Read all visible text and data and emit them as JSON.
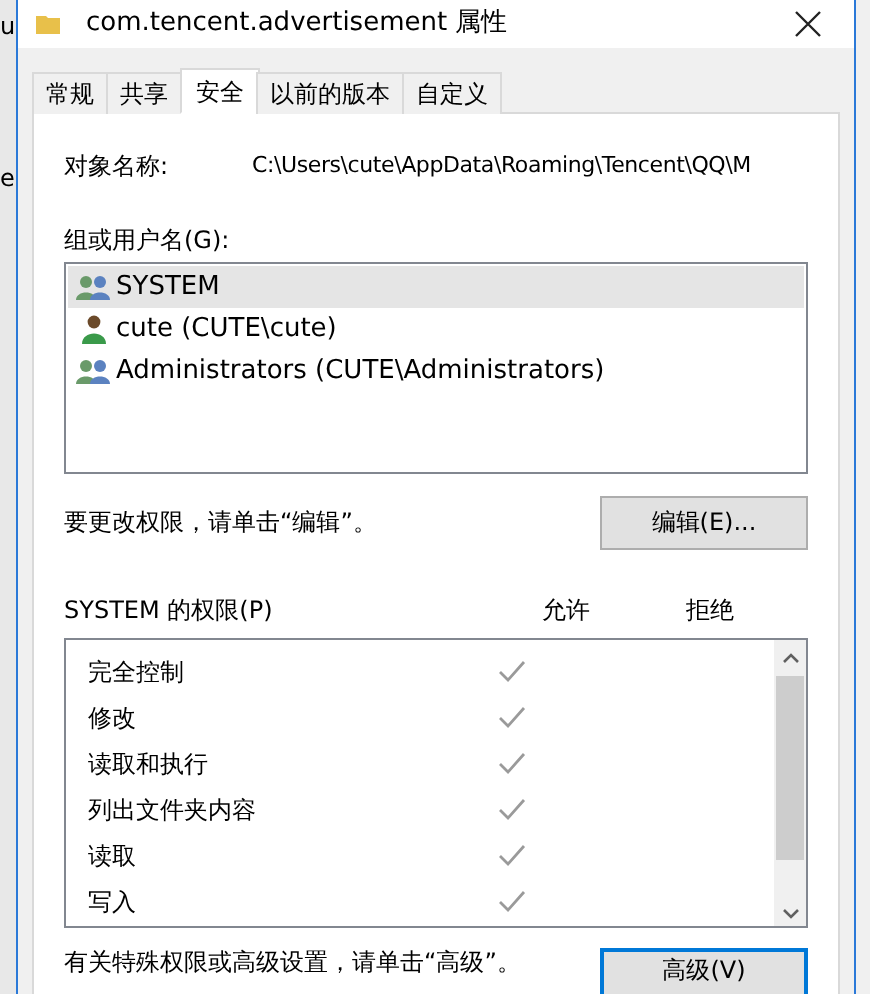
{
  "background_window": {
    "fragments": [
      "u",
      "e"
    ]
  },
  "window": {
    "title": "com.tencent.advertisement 属性"
  },
  "tabs": [
    {
      "label": "常规",
      "selected": false
    },
    {
      "label": "共享",
      "selected": false
    },
    {
      "label": "安全",
      "selected": true
    },
    {
      "label": "以前的版本",
      "selected": false
    },
    {
      "label": "自定义",
      "selected": false
    }
  ],
  "object_name": {
    "label": "对象名称:",
    "value": "C:\\Users\\cute\\AppData\\Roaming\\Tencent\\QQ\\M"
  },
  "users": {
    "label": "组或用户名(G):",
    "items": [
      {
        "name": "SYSTEM",
        "kind": "group",
        "selected": true
      },
      {
        "name": "cute (CUTE\\cute)",
        "kind": "user",
        "selected": false
      },
      {
        "name": "Administrators (CUTE\\Administrators)",
        "kind": "group",
        "selected": false
      }
    ]
  },
  "edit_hint": "要更改权限，请单击“编辑”。",
  "edit_button": "编辑(E)...",
  "permissions": {
    "label": "SYSTEM 的权限(P)",
    "allow_header": "允许",
    "deny_header": "拒绝",
    "rows": [
      {
        "name": "完全控制",
        "allow": true,
        "deny": false
      },
      {
        "name": "修改",
        "allow": true,
        "deny": false
      },
      {
        "name": "读取和执行",
        "allow": true,
        "deny": false
      },
      {
        "name": "列出文件夹内容",
        "allow": true,
        "deny": false
      },
      {
        "name": "读取",
        "allow": true,
        "deny": false
      },
      {
        "name": "写入",
        "allow": true,
        "deny": false
      }
    ]
  },
  "advanced_hint": "有关特殊权限或高级设置，请单击“高级”。",
  "advanced_button": "高级(V)"
}
